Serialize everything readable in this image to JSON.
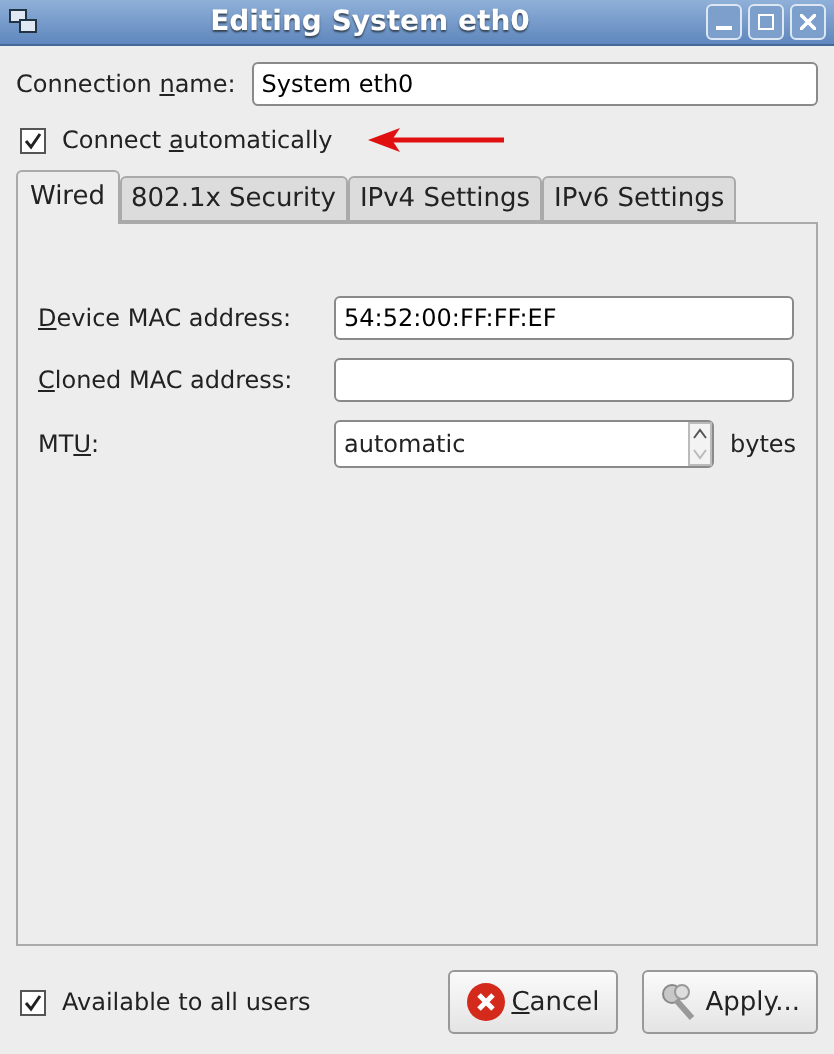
{
  "window": {
    "title": "Editing System eth0"
  },
  "connection_name": {
    "label": {
      "before": "Connection ",
      "key": "n",
      "after": "ame:"
    },
    "value": "System eth0"
  },
  "connect_automatically": {
    "label": {
      "before": "Connect ",
      "key": "a",
      "after": "utomatically"
    },
    "checked": true
  },
  "tabs": [
    {
      "label": "Wired",
      "selected": true
    },
    {
      "label": "802.1x Security",
      "selected": false
    },
    {
      "label": "IPv4 Settings",
      "selected": false
    },
    {
      "label": "IPv6 Settings",
      "selected": false
    }
  ],
  "wired": {
    "fields": [
      {
        "kind": "text",
        "label": {
          "key": "D",
          "after": "evice MAC address:"
        },
        "value": "54:52:00:FF:FF:EF"
      },
      {
        "kind": "text",
        "label": {
          "key": "C",
          "after": "loned MAC address:"
        }
      },
      {
        "kind": "spin",
        "label": {
          "before": "MT",
          "key": "U",
          "after": ":"
        },
        "value": "automatic",
        "unit": "bytes"
      }
    ]
  },
  "available_to_all_users": {
    "label": {
      "before": "Available to all users"
    },
    "checked": true
  },
  "buttons": [
    {
      "kind": "cancel",
      "label": {
        "key": "C",
        "after": "ancel"
      }
    },
    {
      "kind": "apply",
      "label": {
        "before": "Apply..."
      }
    }
  ]
}
